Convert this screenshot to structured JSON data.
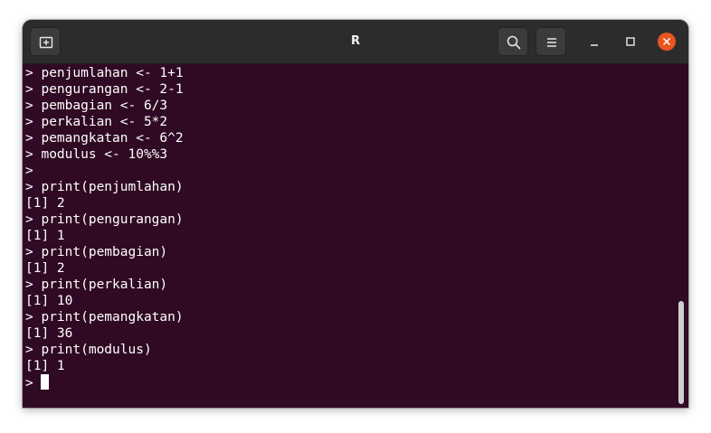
{
  "window": {
    "title": "R"
  },
  "toolbar": {
    "new_tab_icon": "new-tab-icon",
    "search_icon": "search-icon",
    "menu_icon": "hamburger-menu-icon"
  },
  "terminal": {
    "lines": [
      "> penjumlahan <- 1+1",
      "> pengurangan <- 2-1",
      "> pembagian <- 6/3",
      "> perkalian <- 5*2",
      "> pemangkatan <- 6^2",
      "> modulus <- 10%%3",
      ">",
      "> print(penjumlahan)",
      "[1] 2",
      "> print(pengurangan)",
      "[1] 1",
      "> print(pembagian)",
      "[1] 2",
      "> print(perkalian)",
      "[1] 10",
      "> print(pemangkatan)",
      "[1] 36",
      "> print(modulus)",
      "[1] 1"
    ],
    "prompt": "> "
  },
  "colors": {
    "terminal_background": "#300a24",
    "titlebar_background": "#2c2c2c",
    "close_button": "#e95420",
    "text": "#ffffff"
  }
}
